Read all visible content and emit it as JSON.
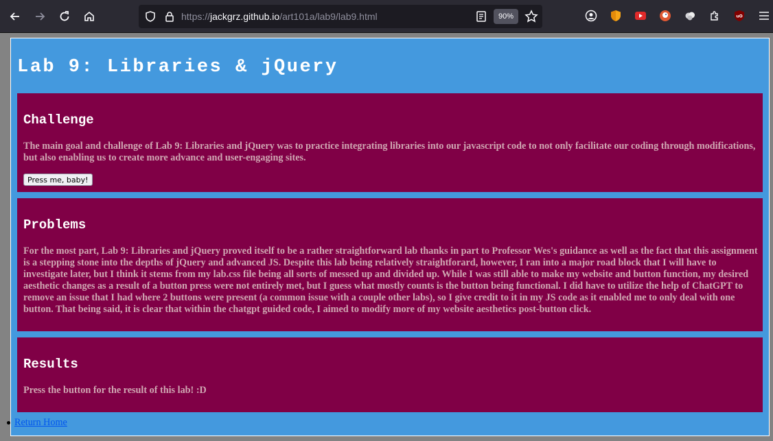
{
  "browser": {
    "url_prefix": "https://",
    "url_host": "jackgrz.github.io",
    "url_path": "/art101a/lab9/lab9.html",
    "zoom": "90%"
  },
  "page": {
    "title": "Lab 9: Libraries & jQuery",
    "challenge": {
      "heading": "Challenge",
      "text": "The main goal and challenge of Lab 9: Libraries and jQuery was to practice integrating libraries into our javascript code to not only facilitate our coding through modifications, but also enabling us to create more advance and user-engaging sites.",
      "button_label": "Press me, baby!"
    },
    "problems": {
      "heading": "Problems",
      "text": "For the most part, Lab 9: Libraries and jQuery proved itself to be a rather straightforward lab thanks in part to Professor Wes's guidance as well as the fact that this assignment is a stepping stone into the depths of jQuery and advanced JS. Despite this lab being relatively straightforard, however, I ran into a major road block that I will have to investigate later, but I think it stems from my lab.css file being all sorts of messed up and divided up. While I was still able to make my website and button function, my desired aesthetic changes as a result of a button press were not entirely met, but I guess what mostly counts is the button being functional. I did have to utilize the help of ChatGPT to remove an issue that I had where 2 buttons were present (a common issue with a couple other labs), so I give credit to it in my JS code as it enabled me to only deal with one button. That being said, it is clear that within the chatgpt guided code, I aimed to modify more of my website aesthetics post-button click."
    },
    "results": {
      "heading": "Results",
      "text": "Press the button for the result of this lab! :D"
    },
    "return_home_link": "Return Home"
  }
}
